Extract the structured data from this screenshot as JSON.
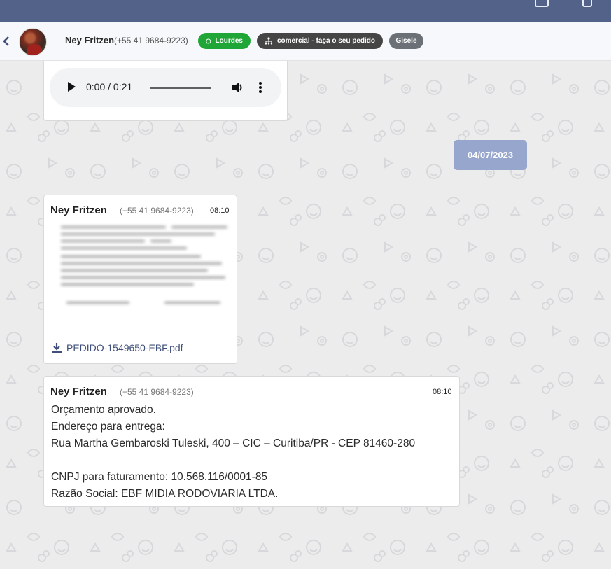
{
  "header": {
    "contact_name": "Ney Fritzen",
    "contact_phone": "(+55 41 9684-9223)",
    "tags": [
      {
        "label": "Lourdes",
        "color": "#1fa636",
        "icon": "whatsapp-icon"
      },
      {
        "label": "comercial - faça o seu pedido",
        "color": "#454545",
        "icon": "org-chart-icon"
      },
      {
        "label": "Gisele",
        "color": "#6b6f76"
      }
    ]
  },
  "audio": {
    "time_display": "0:00 / 0:21"
  },
  "date_divider": "04/07/2023",
  "messages": [
    {
      "sender": "Ney Fritzen",
      "phone": "(+55 41 9684-9223)",
      "time": "08:10",
      "attachment": "PEDIDO-1549650-EBF.pdf"
    },
    {
      "sender": "Ney Fritzen",
      "phone": "(+55 41 9684-9223)",
      "time": "08:10",
      "lines": [
        "Orçamento aprovado.",
        "Endereço para entrega:",
        "Rua Martha Gembaroski Tuleski, 400 – CIC – Curitiba/PR - CEP 81460-280",
        "",
        "CNPJ para faturamento: 10.568.116/0001-85",
        "Razão Social: EBF MIDIA RODOVIARIA LTDA."
      ]
    }
  ],
  "colors": {
    "topbar": "#536289",
    "date_chip": "#96a6cc",
    "link": "#3f4f7a"
  }
}
